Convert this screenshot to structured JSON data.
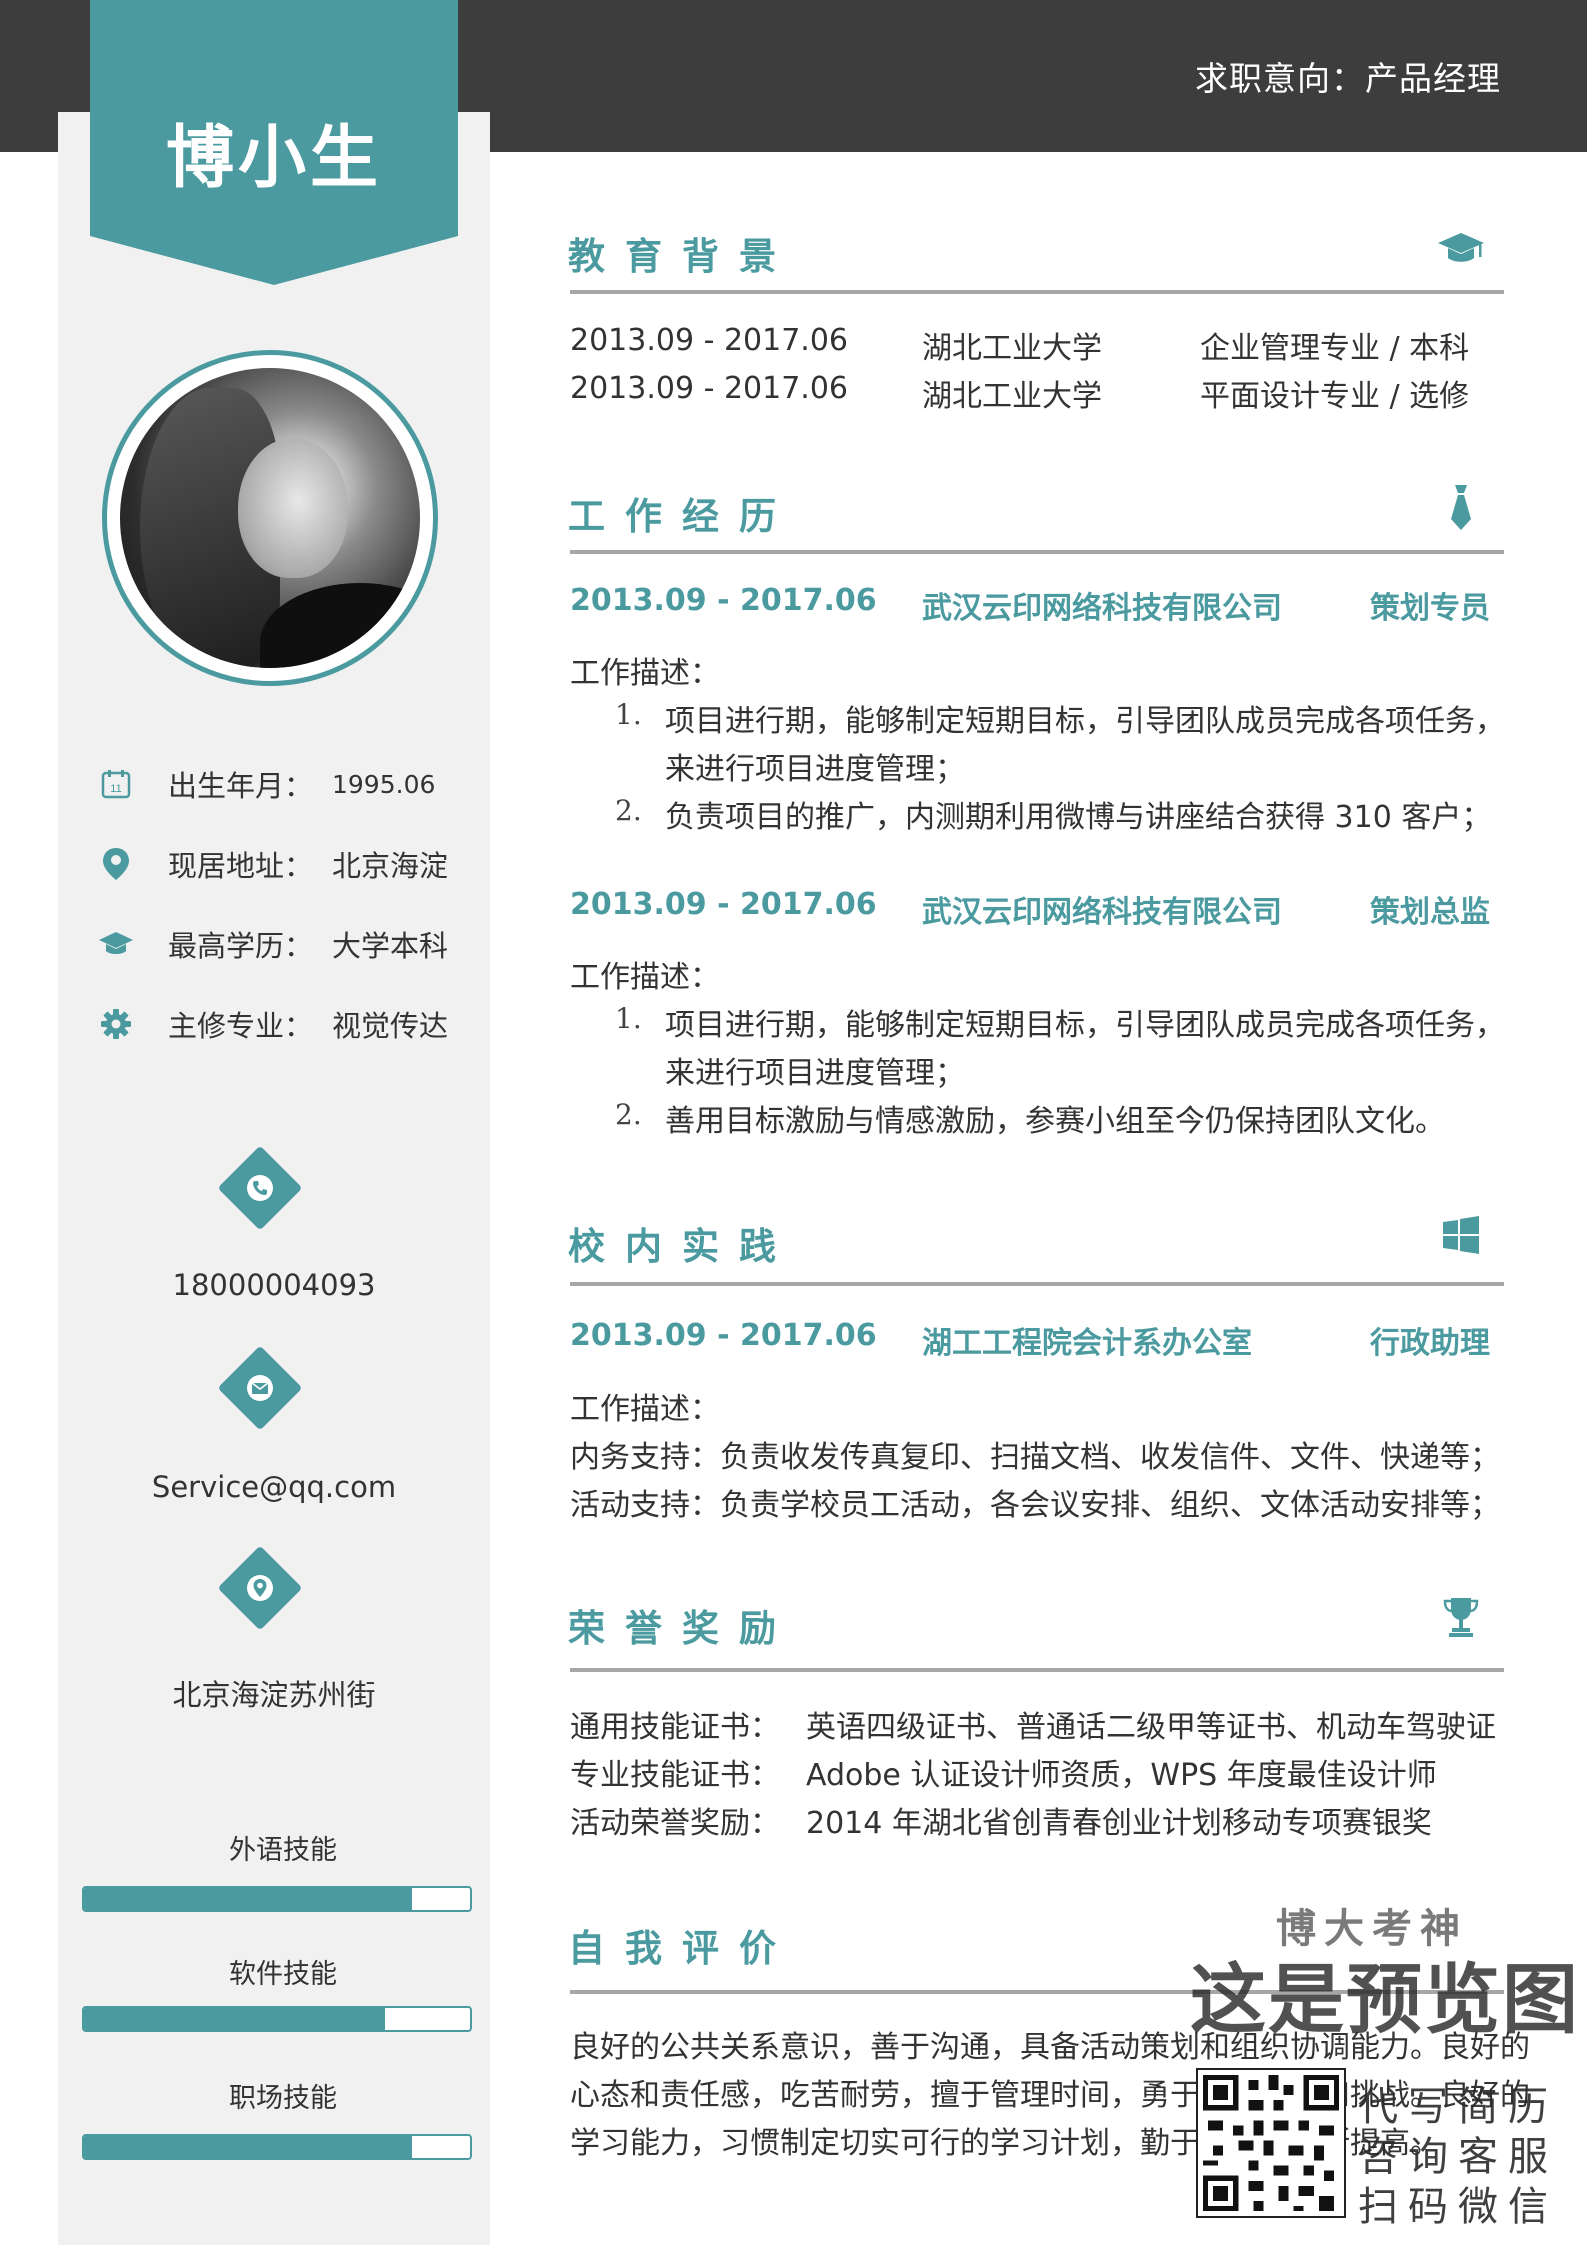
{
  "header": {
    "job_intention": "求职意向：产品经理"
  },
  "profile": {
    "name": "博小生"
  },
  "info": [
    {
      "icon": "calendar-icon",
      "label": "出生年月：",
      "value": "1995.06"
    },
    {
      "icon": "map-pin-icon",
      "label": "现居地址：",
      "value": "北京海淀"
    },
    {
      "icon": "graduation-cap-icon",
      "label": "最高学历：",
      "value": "大学本科"
    },
    {
      "icon": "gear-icon",
      "label": "主修专业：",
      "value": "视觉传达"
    }
  ],
  "contact": {
    "phone": "18000004093",
    "email": "Service@qq.com",
    "address": "北京海淀苏州街"
  },
  "skills": [
    {
      "label": "外语技能",
      "level": 0.85
    },
    {
      "label": "软件技能",
      "level": 0.78
    },
    {
      "label": "职场技能",
      "level": 0.85
    }
  ],
  "education": {
    "title": "教育背景",
    "rows": [
      {
        "date": "2013.09 - 2017.06",
        "school": "湖北工业大学",
        "major": "企业管理专业  /  本科"
      },
      {
        "date": "2013.09 - 2017.06",
        "school": "湖北工业大学",
        "major": "平面设计专业  /  选修"
      }
    ]
  },
  "work": {
    "title": "工作经历",
    "jobs": [
      {
        "date": "2013.09 - 2017.06",
        "company": "武汉云印网络科技有限公司",
        "role": "策划专员",
        "desc_label": "工作描述：",
        "items": [
          {
            "num": "1.",
            "lines": [
              "项目进行期，能够制定短期目标，引导团队成员完成各项任务，",
              "来进行项目进度管理；"
            ]
          },
          {
            "num": "2.",
            "lines": [
              "负责项目的推广，内测期利用微博与讲座结合获得 310 客户；"
            ]
          }
        ]
      },
      {
        "date": "2013.09 - 2017.06",
        "company": "武汉云印网络科技有限公司",
        "role": "策划总监",
        "desc_label": "工作描述：",
        "items": [
          {
            "num": "1.",
            "lines": [
              "项目进行期，能够制定短期目标，引导团队成员完成各项任务，",
              "来进行项目进度管理；"
            ]
          },
          {
            "num": "2.",
            "lines": [
              "善用目标激励与情感激励，参赛小组至今仍保持团队文化。"
            ]
          }
        ]
      }
    ]
  },
  "campus": {
    "title": "校内实践",
    "date": "2013.09 - 2017.06",
    "org": "湖工工程院会计系办公室",
    "role": "行政助理",
    "desc_label": "工作描述：",
    "lines": [
      "内务支持：负责收发传真复印、扫描文档、收发信件、文件、快递等；",
      "活动支持：负责学校员工活动，各会议安排、组织、文体活动安排等；"
    ]
  },
  "honors": {
    "title": "荣誉奖励",
    "rows": [
      {
        "label": "通用技能证书：",
        "value": "英语四级证书、普通话二级甲等证书、机动车驾驶证"
      },
      {
        "label": "专业技能证书：",
        "value": "Adobe 认证设计师资质，WPS 年度最佳设计师"
      },
      {
        "label": "活动荣誉奖励：",
        "value": "2014 年湖北省创青春创业计划移动专项赛银奖"
      }
    ]
  },
  "self_eval": {
    "title": "自我评价",
    "lines": [
      "良好的公共关系意识，善于沟通，具备活动策划和组织协调能力。良好的",
      "心态和责任感，吃苦耐劳，擅于管理时间，勇于面对变化和挑战。良好的",
      "学习能力，习惯制定切实可行的学习计划，勤于学习能不断提高。"
    ]
  },
  "watermark": {
    "brand": "博大考神",
    "preview": "这是预览图",
    "lines": [
      "代写简历",
      "咨询客服",
      "扫码微信"
    ]
  },
  "colors": {
    "accent": "#4a9aa0",
    "dark": "#3d3d3d",
    "sidebar": "#f1f1f1"
  }
}
